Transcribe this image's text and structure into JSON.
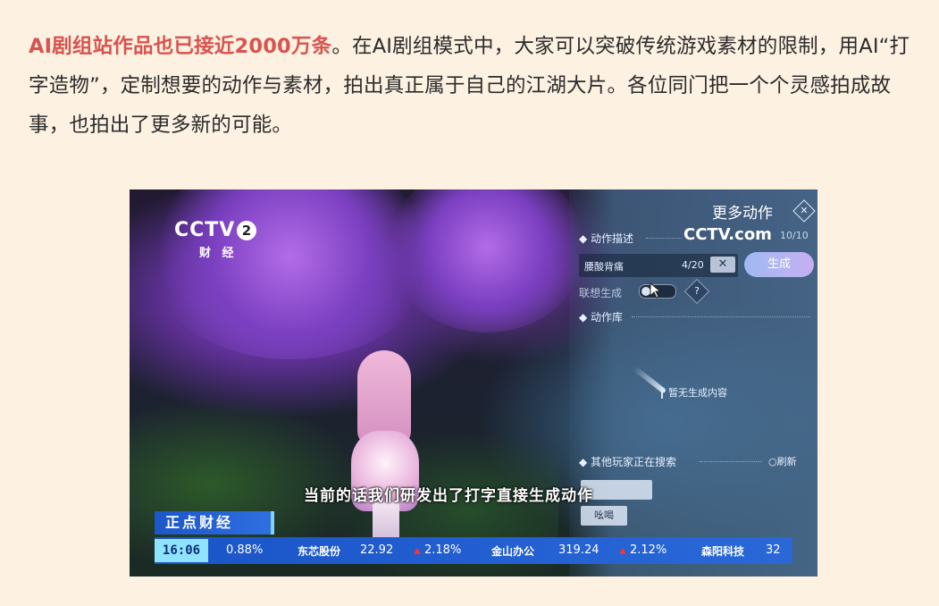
{
  "article": {
    "highlight": "AI剧组站作品也已接近2000万条",
    "body": "。在AI剧组模式中，大家可以突破传统游戏素材的限制，用AI“打字造物”，定制想要的动作与素材，拍出真正属于自己的江湖大片。各位同门把一个个灵感拍成故事，也拍出了更多新的可能。"
  },
  "video": {
    "channel_logo": "CCTV",
    "channel_number": "2",
    "channel_name": "财 经",
    "subtitle": "当前的话我们研发出了打字直接生成动作",
    "game_ui": {
      "title": "更多动作",
      "close_icon": "close-icon",
      "action_desc_label": "◆ 动作描述",
      "watermark": "CCTV.com",
      "count": "10/10",
      "input_value": "腰酸背痛",
      "input_count": "4/20",
      "clear_label": "✕",
      "generate_label": "生成",
      "assoc_label": "联想生成",
      "help_label": "?",
      "library_label": "◆ 动作库",
      "empty_text": "暂无生成内容",
      "others_label": "◆ 其他玩家正在搜索",
      "refresh_label": "○刷新",
      "chip1": "",
      "chip2": "吆喝"
    },
    "news_banner": "正点财经",
    "ticker": {
      "time": "16:06",
      "items": [
        {
          "name": "",
          "value": "",
          "change": "0.88%",
          "up": false
        },
        {
          "name": "东芯股份",
          "value": "22.92",
          "change": "2.18%",
          "up": true
        },
        {
          "name": "金山办公",
          "value": "319.24",
          "change": "2.12%",
          "up": true
        },
        {
          "name": "森阳科技",
          "value": "32",
          "change": "",
          "up": false
        }
      ]
    }
  },
  "colors": {
    "background": "#fdf1e2",
    "highlight": "#d9534f",
    "ticker_blue": "#1a55c7",
    "ticker_time_bg": "#8fe3ff",
    "up_arrow": "#ff3030"
  }
}
